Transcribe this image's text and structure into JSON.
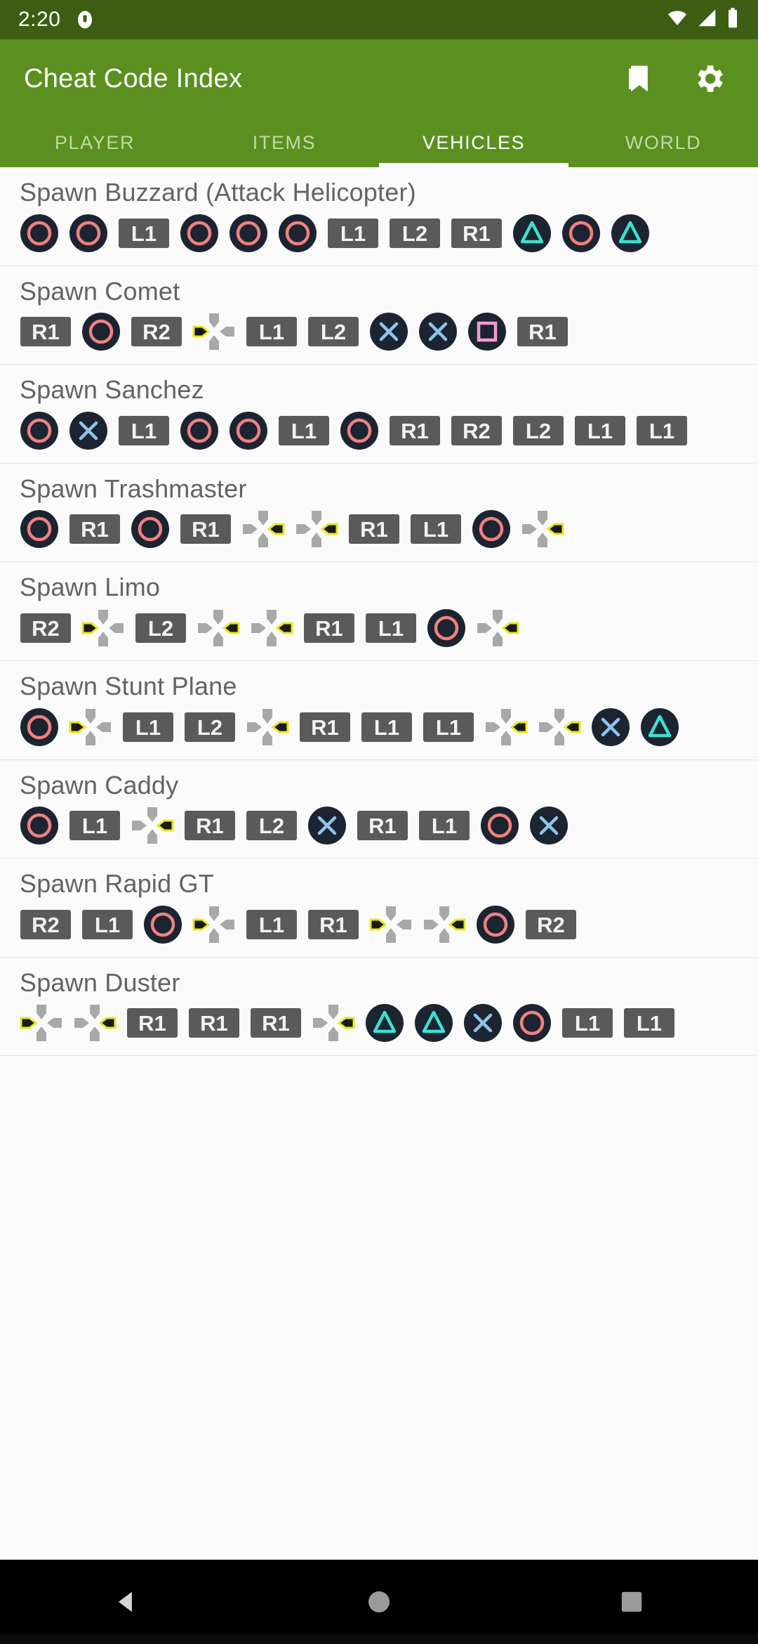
{
  "statusbar": {
    "time": "2:20",
    "notification_icon": "app-notification-icon",
    "wifi_icon": "wifi-icon",
    "signal_icon": "cellular-signal-icon",
    "battery_icon": "battery-icon"
  },
  "appbar": {
    "title": "Cheat Code Index",
    "bookmark_icon": "bookmark-icon",
    "settings_icon": "gear-icon"
  },
  "tabs": {
    "active_index": 2,
    "items": [
      {
        "label": "PLAYER"
      },
      {
        "label": "ITEMS"
      },
      {
        "label": "VEHICLES"
      },
      {
        "label": "WORLD"
      }
    ]
  },
  "colors": {
    "appbar_green": "#5b9020",
    "statusbar_green": "#3d5e12",
    "tab_active_text": "#ffffff",
    "tab_inactive_text": "#c3d9a5",
    "list_background": "#fafafa",
    "entry_title": "#636363",
    "divider": "#e4e4e4",
    "circle_button": "#f08080",
    "cross_button": "#8ec4ea",
    "triangle_button": "#3de0d0",
    "square_button": "#f49ad0",
    "face_button_fill": "#1b2430",
    "shoulder_button_fill": "#5a5a5a",
    "dpad_idle": "#a8a8a8",
    "dpad_active_fill": "#1a1a1a",
    "dpad_active_outline": "#e8e81e",
    "navbar": "#000000"
  },
  "cheats": [
    {
      "name": "Spawn Buzzard (Attack Helicopter)",
      "buttons": [
        "circle",
        "circle",
        "L1",
        "circle",
        "circle",
        "circle",
        "L1",
        "L2",
        "R1",
        "triangle",
        "circle",
        "triangle"
      ]
    },
    {
      "name": "Spawn Comet",
      "buttons": [
        "R1",
        "circle",
        "R2",
        "dpad-left",
        "L1",
        "L2",
        "cross",
        "cross",
        "square",
        "R1"
      ]
    },
    {
      "name": "Spawn Sanchez",
      "buttons": [
        "circle",
        "cross",
        "L1",
        "circle",
        "circle",
        "L1",
        "circle",
        "R1",
        "R2",
        "L2",
        "L1",
        "L1"
      ]
    },
    {
      "name": "Spawn Trashmaster",
      "buttons": [
        "circle",
        "R1",
        "circle",
        "R1",
        "dpad-right",
        "dpad-right",
        "R1",
        "L1",
        "circle",
        "dpad-right"
      ]
    },
    {
      "name": "Spawn Limo",
      "buttons": [
        "R2",
        "dpad-left",
        "L2",
        "dpad-right",
        "dpad-right",
        "R1",
        "L1",
        "circle",
        "dpad-right"
      ]
    },
    {
      "name": "Spawn Stunt Plane",
      "buttons": [
        "circle",
        "dpad-left",
        "L1",
        "L2",
        "dpad-right",
        "R1",
        "L1",
        "L1",
        "dpad-right",
        "dpad-right",
        "cross",
        "triangle"
      ]
    },
    {
      "name": "Spawn Caddy",
      "buttons": [
        "circle",
        "L1",
        "dpad-right",
        "R1",
        "L2",
        "cross",
        "R1",
        "L1",
        "circle",
        "cross"
      ]
    },
    {
      "name": "Spawn Rapid GT",
      "buttons": [
        "R2",
        "L1",
        "circle",
        "dpad-left",
        "L1",
        "R1",
        "dpad-left",
        "dpad-right",
        "circle",
        "R2"
      ]
    },
    {
      "name": "Spawn Duster",
      "buttons": [
        "dpad-left",
        "dpad-right",
        "R1",
        "R1",
        "R1",
        "dpad-right",
        "triangle",
        "triangle",
        "cross",
        "circle",
        "L1",
        "L1"
      ]
    }
  ],
  "navbar": {
    "back_icon": "back-triangle-icon",
    "home_icon": "home-circle-icon",
    "recents_icon": "recents-square-icon"
  }
}
